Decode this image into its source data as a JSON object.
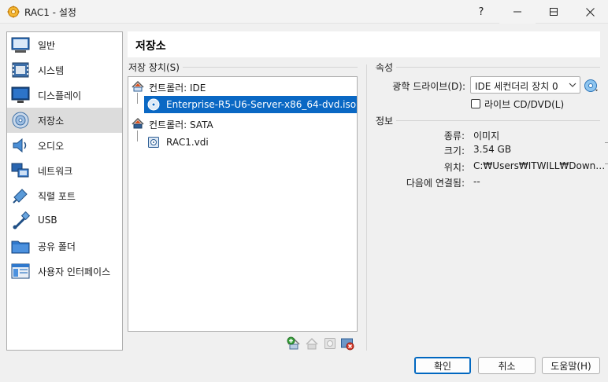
{
  "window": {
    "title": "RAC1 - 설정"
  },
  "nav": {
    "items": [
      {
        "label": "일반",
        "icon": "general-icon"
      },
      {
        "label": "시스템",
        "icon": "system-icon"
      },
      {
        "label": "디스플레이",
        "icon": "display-icon"
      },
      {
        "label": "저장소",
        "icon": "storage-icon",
        "selected": true
      },
      {
        "label": "오디오",
        "icon": "audio-icon"
      },
      {
        "label": "네트워크",
        "icon": "network-icon"
      },
      {
        "label": "직렬 포트",
        "icon": "serial-port-icon"
      },
      {
        "label": "USB",
        "icon": "usb-icon"
      },
      {
        "label": "공유 폴더",
        "icon": "shared-folder-icon"
      },
      {
        "label": "사용자 인터페이스",
        "icon": "user-interface-icon"
      }
    ]
  },
  "page": {
    "title": "저장소"
  },
  "storage": {
    "section_label": "저장 장치(S)",
    "tree": [
      {
        "label": "컨트롤러: IDE",
        "type": "controller"
      },
      {
        "label": "Enterprise-R5-U6-Server-x86_64-dvd.iso",
        "type": "optical",
        "selected": true
      },
      {
        "label": "컨트롤러: SATA",
        "type": "controller"
      },
      {
        "label": "RAC1.vdi",
        "type": "disk"
      }
    ],
    "toolbar": [
      "add-controller-icon",
      "add-attachment-icon",
      "remove-attachment-icon",
      "remove-controller-icon"
    ]
  },
  "attributes": {
    "section_label": "속성",
    "optical_drive_label": "광학 드라이브(D):",
    "optical_drive_value": "IDE 세컨더리 장치 0",
    "live_cd_label": "라이브 CD/DVD(L)",
    "live_cd_checked": false
  },
  "info": {
    "section_label": "정보",
    "rows": [
      {
        "label": "종류:",
        "value": "이미지"
      },
      {
        "label": "크기:",
        "value": "3.54 GB"
      },
      {
        "label": "위치:",
        "value": "C:₩Users₩ITWILL₩Down…"
      },
      {
        "label": "다음에 연결됨:",
        "value": "--"
      }
    ]
  },
  "buttons": {
    "ok": "확인",
    "cancel": "취소",
    "help": "도움말(H)"
  },
  "colors": {
    "selection": "#0a68c4",
    "accent": "#0067c0"
  }
}
